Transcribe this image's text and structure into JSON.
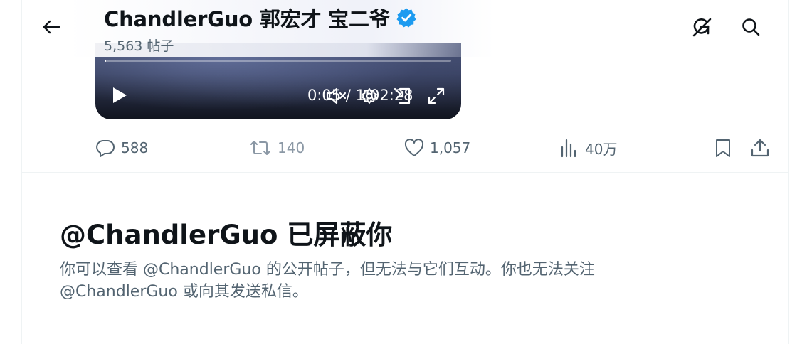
{
  "header": {
    "title": "ChandlerGuo 郭宏才 宝二爷",
    "post_count": "5,563 帖子",
    "icons": [
      "back-arrow-icon",
      "verified-badge-icon",
      "grok-icon",
      "search-icon"
    ]
  },
  "video": {
    "time": "0:05 / 1:02:28",
    "progress": 0.0013,
    "icons": [
      "play-icon",
      "mute-icon",
      "settings-icon",
      "pip-icon",
      "fullscreen-icon"
    ]
  },
  "actions": {
    "replies": "588",
    "reposts": "140",
    "likes": "1,057",
    "views": "40万"
  },
  "blocked": {
    "title": "@ChandlerGuo 已屏蔽你",
    "line1": "你可以查看 @ChandlerGuo 的公开帖子，但无法与它们互动。你也无法关注",
    "line2": "@ChandlerGuo 或向其发送私信。"
  },
  "colors": {
    "text_primary": "#0f1419",
    "text_secondary": "#536471",
    "verified_blue": "#1d9bf0",
    "divider": "#eff3f4"
  }
}
